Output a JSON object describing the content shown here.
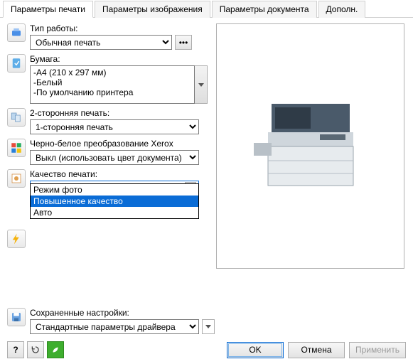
{
  "tabs": {
    "print": "Параметры печати",
    "image": "Параметры изображения",
    "doc": "Параметры документа",
    "more": "Дополн."
  },
  "job": {
    "label": "Тип работы:",
    "value": "Обычная печать"
  },
  "paper": {
    "label": "Бумага:",
    "line1": "-A4 (210 x 297 мм)",
    "line2": "-Белый",
    "line3": "-По умолчанию принтера"
  },
  "duplex": {
    "label": "2-сторонняя печать:",
    "value": "1-сторонняя печать"
  },
  "bw": {
    "label": "Черно-белое преобразование Xerox",
    "value": "Выкл (использовать цвет документа)"
  },
  "quality": {
    "label": "Качество печати:",
    "value": "Повышенное качество",
    "opt1": "Режим фото",
    "opt2": "Повышенное качество",
    "opt3": "Авто"
  },
  "saved": {
    "label": "Сохраненные настройки:",
    "value": "Стандартные параметры драйвера"
  },
  "buttons": {
    "ok": "OK",
    "cancel": "Отмена",
    "apply": "Применить"
  },
  "help": "?"
}
